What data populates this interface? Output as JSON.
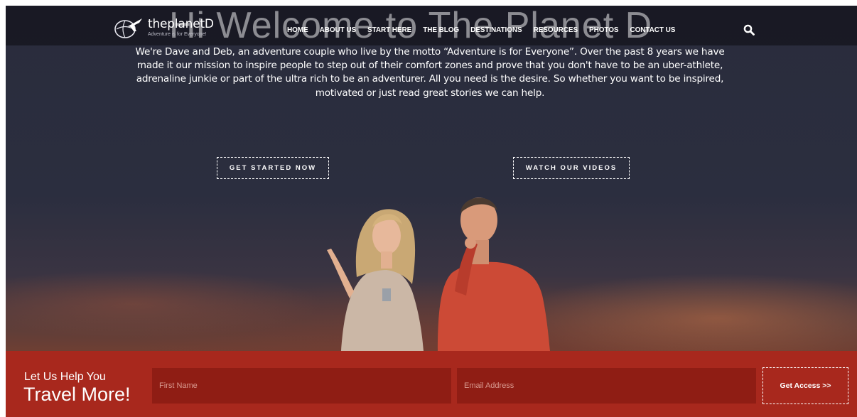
{
  "header": {
    "ghost_title": "Hi Welcome to The Planet D",
    "logo_name": "theplanetD",
    "logo_tagline": "Adventure is for Everyone!",
    "nav": [
      "HOME",
      "ABOUT US",
      "START HERE",
      "THE BLOG",
      "DESTINATIONS",
      "RESOURCES",
      "PHOTOS",
      "CONTACT US"
    ],
    "search_icon": "search-icon"
  },
  "hero": {
    "intro": "We're Dave and Deb, an adventure couple who live by the motto “Adventure is for Everyone”. Over the past 8 years we have made it our mission to inspire people to step out of their comfort zones and prove that you don't have to be an uber-athlete, adrenaline junkie or part of the ultra rich to be an adventurer. All you need is the desire. So whether you want to be inspired, motivated or just read great stories we can help.",
    "cta_start": "GET STARTED NOW",
    "cta_videos": "WATCH OUR VIDEOS"
  },
  "signup": {
    "line1": "Let Us Help You",
    "line2": "Travel More!",
    "first_name_placeholder": "First Name",
    "email_placeholder": "Email Address",
    "button": "Get Access >>"
  },
  "colors": {
    "signup_bg": "#a8281d",
    "field_bg": "#8f1d14",
    "hero_bg": "#2b2e3f"
  }
}
